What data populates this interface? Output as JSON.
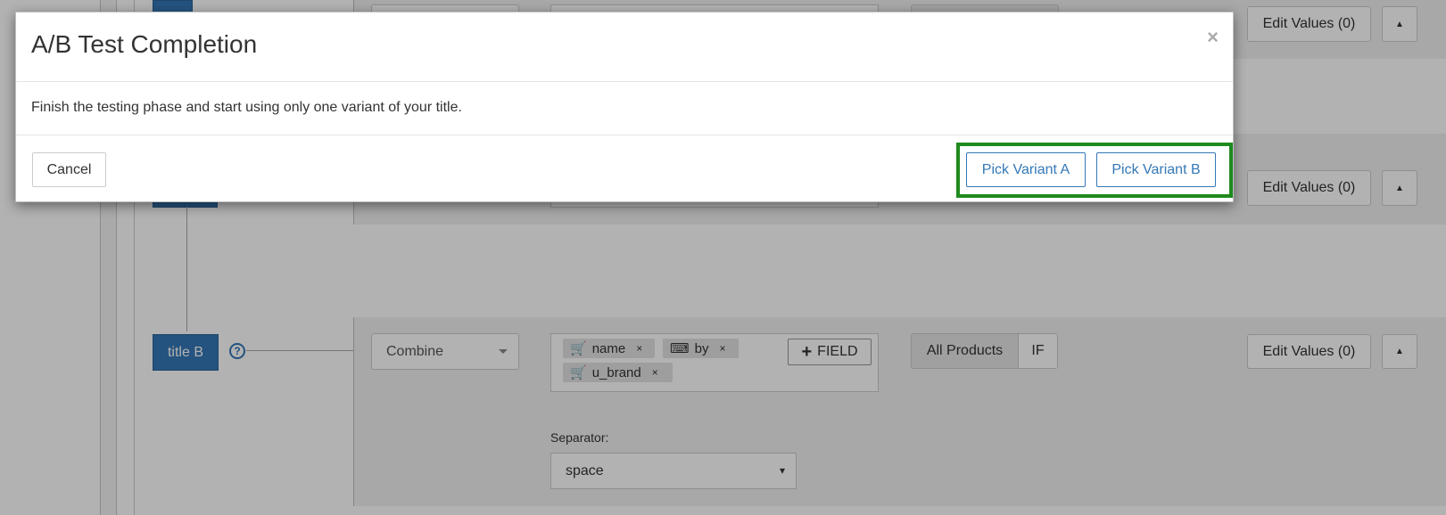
{
  "modal": {
    "title": "A/B Test Completion",
    "close_glyph": "×",
    "body_text": "Finish the testing phase and start using only one variant of your title.",
    "cancel_label": "Cancel",
    "pick_a_label": "Pick Variant A",
    "pick_b_label": "Pick Variant B",
    "highlight_color": "#1e8a1e"
  },
  "background": {
    "edit_values_label": "Edit Values (0)",
    "collapse_glyph": "▲",
    "title_b_label": "title B",
    "help_glyph": "?",
    "combine_label": "Combine",
    "tags": [
      {
        "icon": "cart-icon",
        "glyph": "🛒",
        "label": "name",
        "remove": "×"
      },
      {
        "icon": "keyboard-icon",
        "glyph": "⌨",
        "label": "by",
        "remove": "×"
      },
      {
        "icon": "cart-icon",
        "glyph": "🛒",
        "label": "u_brand",
        "remove": "×"
      }
    ],
    "add_field_plus": "+",
    "add_field_label": "FIELD",
    "all_products_label": "All Products",
    "if_label": "IF",
    "separator_label": "Separator:",
    "separator_value": "space",
    "separator_arrow": "▾"
  },
  "colors": {
    "accent": "#3478b7",
    "overlay": "rgba(0,0,0,0.30)"
  }
}
